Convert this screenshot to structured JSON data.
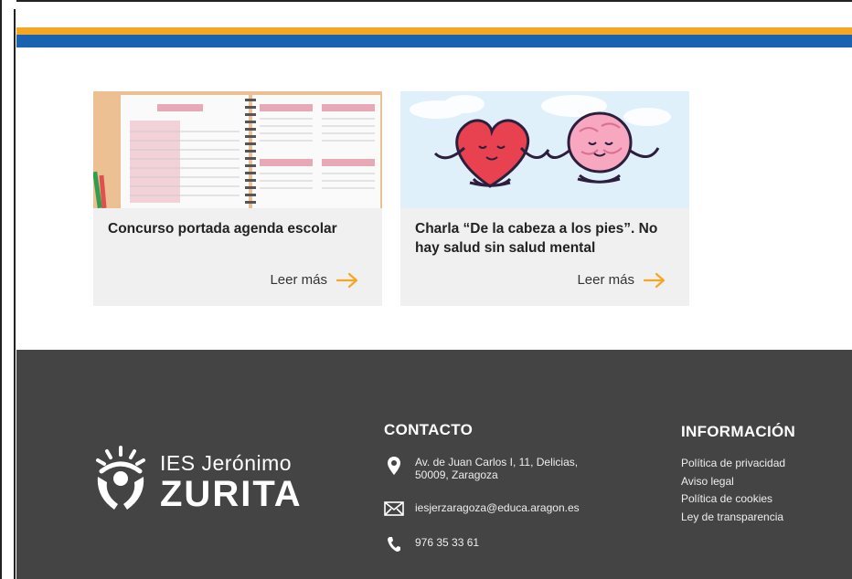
{
  "colors": {
    "accent_orange": "#f5a623",
    "accent_blue": "#1a63b0",
    "footer_bg": "#444444",
    "card_bg": "#f0f0f0"
  },
  "cards": [
    {
      "title": "Concurso portada agenda escolar",
      "read_more": "Leer más",
      "image_icon": "agenda-planner-image",
      "arrow_icon": "arrow-right-icon"
    },
    {
      "title": "Charla “De la cabeza a los pies”. No hay salud sin salud mental",
      "read_more": "Leer más",
      "image_icon": "heart-brain-meditation-image",
      "arrow_icon": "arrow-right-icon"
    }
  ],
  "footer": {
    "logo": {
      "line1": "IES Jerónimo",
      "line2": "ZURITA"
    },
    "contact": {
      "heading": "CONTACTO",
      "address_line1": "Av. de Juan Carlos I, 11, Delicias,",
      "address_line2": "50009, Zaragoza",
      "email": "iesjerzaragoza@educa.aragon.es",
      "phone": "976 35 33 61"
    },
    "info": {
      "heading": "INFORMACIÓN",
      "links": [
        "Política de privacidad",
        "Aviso legal",
        "Política de cookies",
        "Ley de transparencia"
      ]
    }
  }
}
